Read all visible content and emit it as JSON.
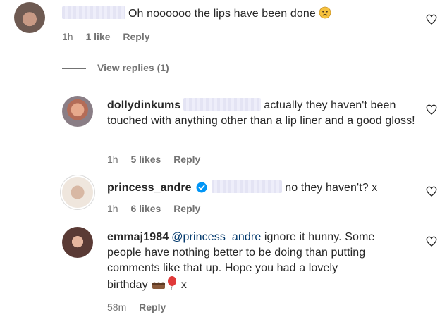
{
  "comments": [
    {
      "username": "",
      "text": "Oh noooooo the lips have been done",
      "emoji": "worried-face",
      "time": "1h",
      "likes": "1 like",
      "reply": "Reply"
    },
    {
      "username": "dollydinkums",
      "text": "actually they haven't been touched with anything other than a lip liner and a good gloss!",
      "time": "1h",
      "likes": "5 likes",
      "reply": "Reply"
    },
    {
      "username": "princess_andre",
      "verified": true,
      "text": "no they haven't? x",
      "time": "1h",
      "likes": "6 likes",
      "reply": "Reply"
    },
    {
      "username": "emmaj1984",
      "mention": "@princess_andre",
      "text_line1": "ignore it hunny. Some",
      "text_line2": "people have nothing better to be doing than putting",
      "text_line3": "comments like that up. Hope you had a lovely",
      "text_line4": "birthday",
      "text_end": "x",
      "emojis": [
        "cake-icon",
        "balloon-icon"
      ],
      "time": "58m",
      "reply": "Reply"
    }
  ],
  "view_replies": "View replies (1)",
  "colors": {
    "text": "#262626",
    "meta": "#737373",
    "mention": "#00376b",
    "verified": "#0095f6"
  }
}
